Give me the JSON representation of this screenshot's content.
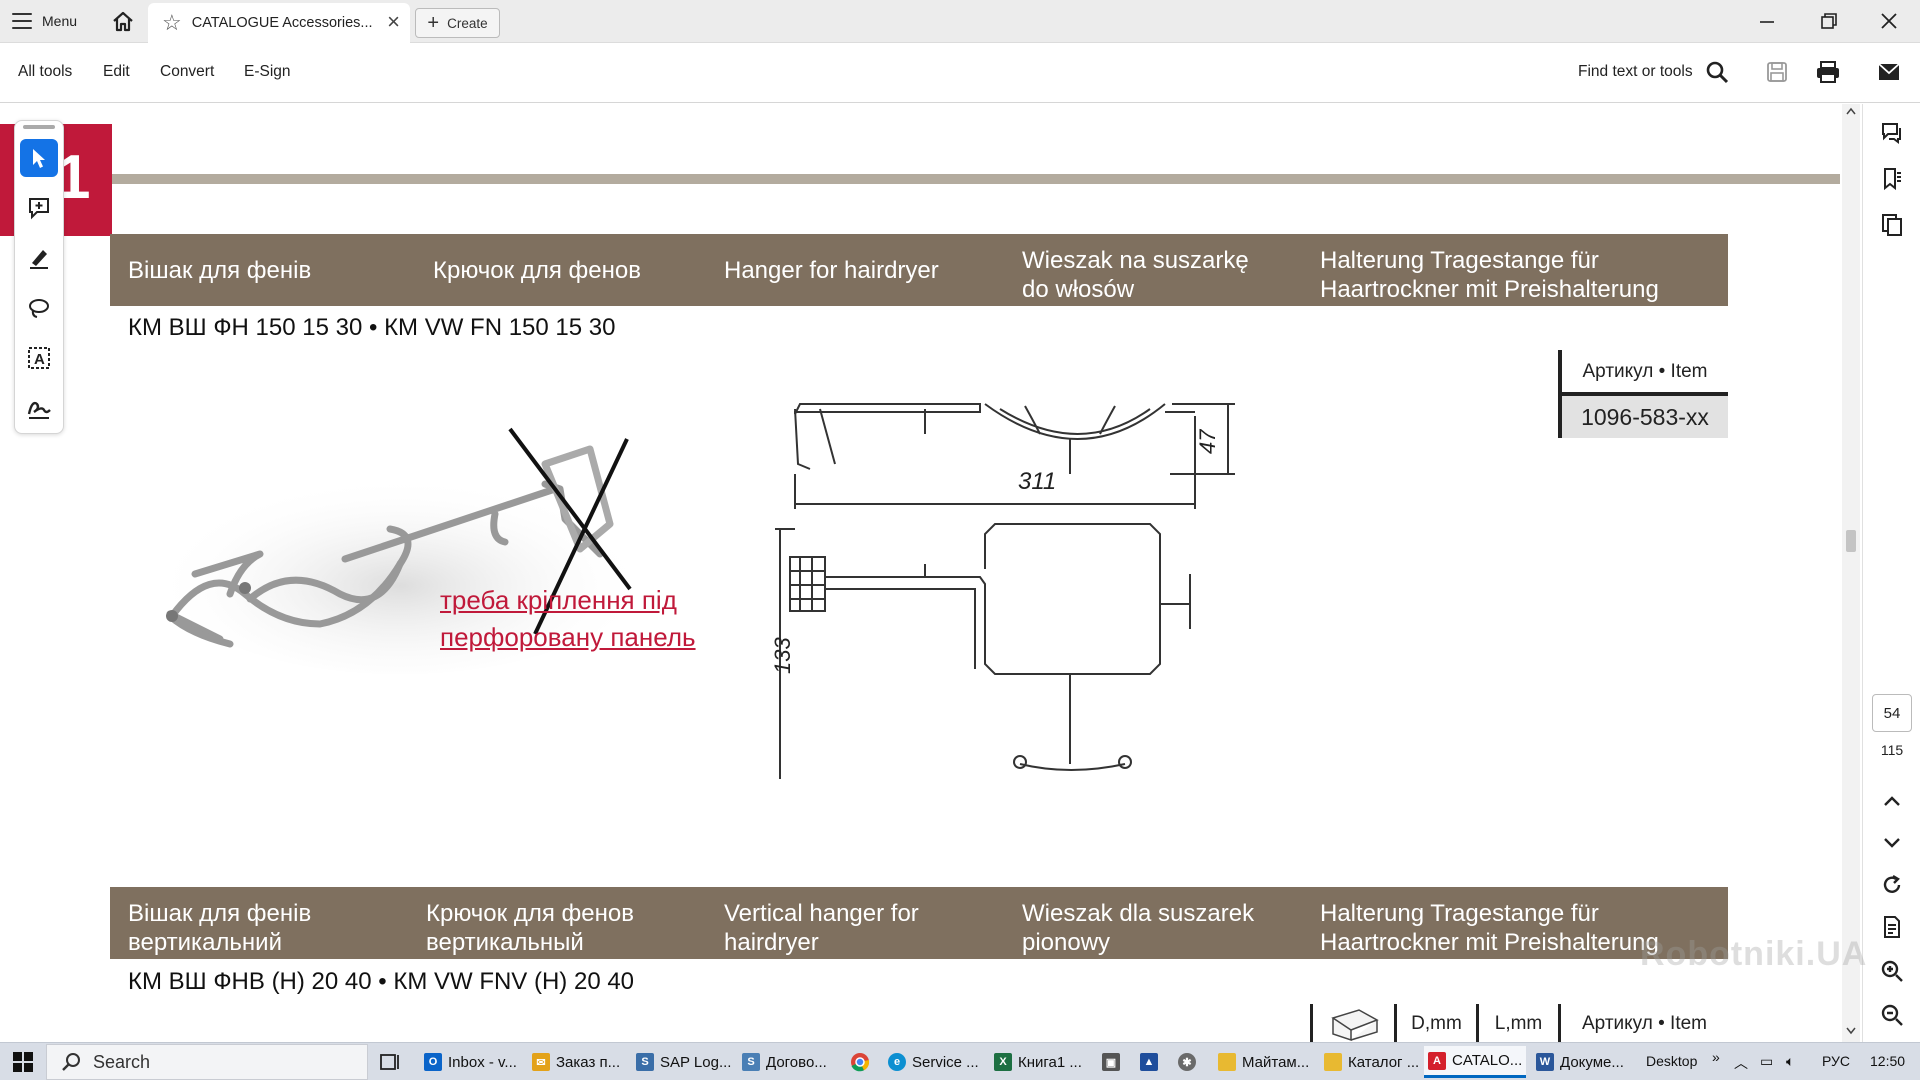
{
  "titlebar": {
    "menu_label": "Menu",
    "tab_title": "CATALOGUE Accessories...",
    "create_label": "Create"
  },
  "toolbar": {
    "items": [
      "All tools",
      "Edit",
      "Convert",
      "E-Sign"
    ],
    "find_label": "Find text or tools"
  },
  "document": {
    "section_number": "1",
    "product1": {
      "headers": [
        "Вішак для фенів",
        "Крючок для фенов",
        "Hanger for hairdryer",
        "Wieszak na suszarkę\ndo włosów",
        "Halterung Tragestange für\nHaartrockner mit Preishalterung"
      ],
      "sku": "КМ ВШ ФН 150 15 30 • КМ VW FN 150 15 30",
      "article_header": "Артикул • Item",
      "article_value": "1096-583-xx",
      "note_line1": "треба кріплення під",
      "note_line2": "перфоровану панель",
      "dim_length": "311",
      "dim_height": "47",
      "dim_width": "133"
    },
    "product2": {
      "headers": [
        "Вішак для фенів\nвертикальний",
        "Крючок для фенов\nвертикальный",
        "Vertical hanger for\nhairdryer",
        "Wieszak dla suszarek\npionowy",
        "Halterung Tragestange für\nHaartrockner mit Preishalterung"
      ],
      "sku": "КМ ВШ ФНВ (Н) 20 40 • КМ VW FNV (H) 20 40",
      "col_d": "D,mm",
      "col_l": "L,mm",
      "col_article": "Артикул • Item"
    }
  },
  "page_nav": {
    "current_page": "54",
    "total_pages": "115"
  },
  "watermark": "Robotniki.UA",
  "taskbar": {
    "search_placeholder": "Search",
    "apps": [
      "Inbox - v...",
      "Заказ п...",
      "SAP Log...",
      "Догово...",
      "Service ...",
      "Книга1 ...",
      "Майтам...",
      "Каталог ...",
      "CATALO...",
      "Докуме..."
    ],
    "desktop_label": "Desktop",
    "lang": "РУС",
    "time": "12:50"
  },
  "colors": {
    "band": "#7f705f",
    "accent_red": "#c0193a",
    "selected_tool": "#1473e6"
  }
}
